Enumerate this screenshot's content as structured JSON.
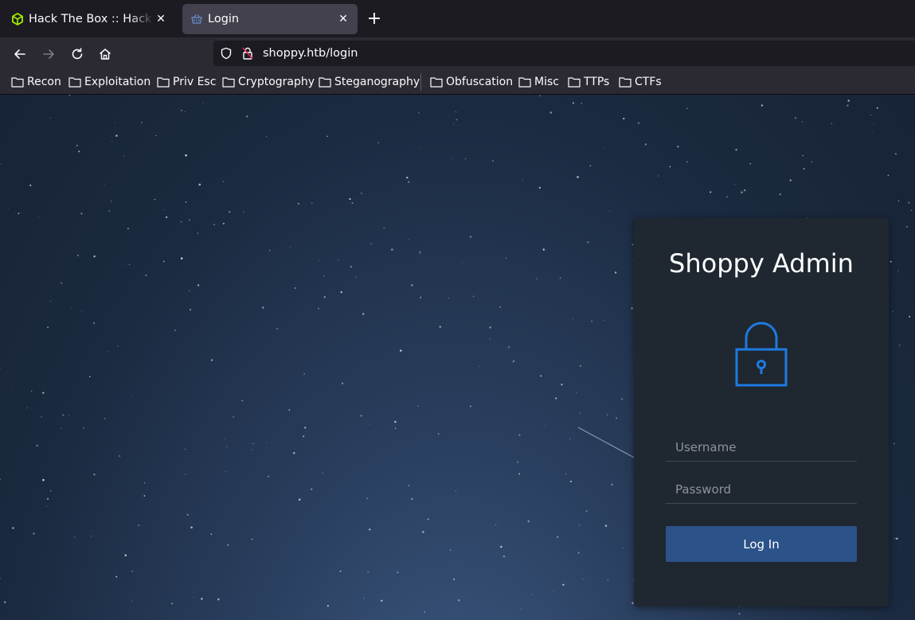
{
  "browser": {
    "tabs": [
      {
        "title": "Hack The Box :: Hack The Box",
        "active": false
      },
      {
        "title": "Login",
        "active": true
      }
    ],
    "new_tab_label": "+",
    "url": "shoppy.htb/login",
    "bookmarks": [
      {
        "label": "Recon"
      },
      {
        "label": "Exploitation"
      },
      {
        "label": "Priv Esc"
      },
      {
        "label": "Cryptography"
      },
      {
        "label": "Steganography"
      },
      {
        "label": "Obfuscation"
      },
      {
        "label": "Misc"
      },
      {
        "label": "TTPs"
      },
      {
        "label": "CTFs"
      }
    ]
  },
  "login": {
    "title": "Shoppy Admin",
    "icon": "padlock-icon",
    "username_placeholder": "Username",
    "password_placeholder": "Password",
    "submit_label": "Log In"
  },
  "colors": {
    "accent": "#2b5289",
    "icon": "#1f7ae0",
    "card_bg": "#1f2731",
    "page_bg": "#1b2a40"
  }
}
